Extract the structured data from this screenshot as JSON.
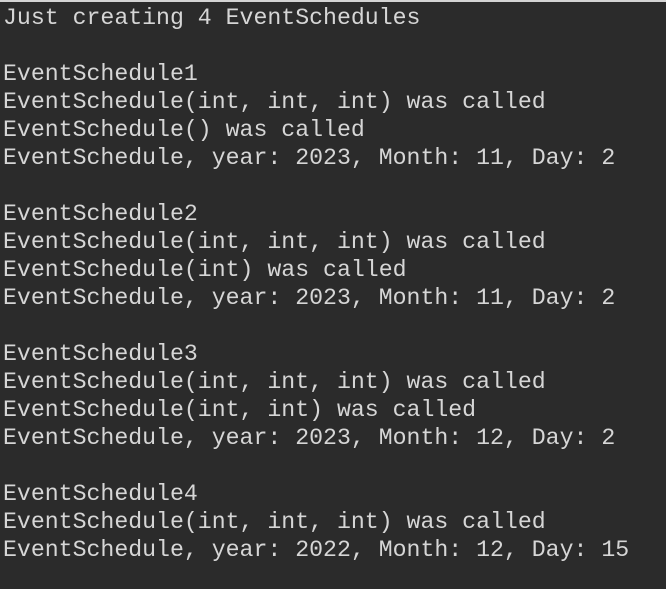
{
  "console": {
    "lines": [
      "Just creating 4 EventSchedules",
      "",
      "EventSchedule1",
      "EventSchedule(int, int, int) was called",
      "EventSchedule() was called",
      "EventSchedule, year: 2023, Month: 11, Day: 2",
      "",
      "EventSchedule2",
      "EventSchedule(int, int, int) was called",
      "EventSchedule(int) was called",
      "EventSchedule, year: 2023, Month: 11, Day: 2",
      "",
      "EventSchedule3",
      "EventSchedule(int, int, int) was called",
      "EventSchedule(int, int) was called",
      "EventSchedule, year: 2023, Month: 12, Day: 2",
      "",
      "EventSchedule4",
      "EventSchedule(int, int, int) was called",
      "EventSchedule, year: 2022, Month: 12, Day: 15"
    ]
  },
  "colors": {
    "background": "#2b2b2b",
    "text": "#d6d6d6",
    "top_border": "#d4d4d4"
  }
}
